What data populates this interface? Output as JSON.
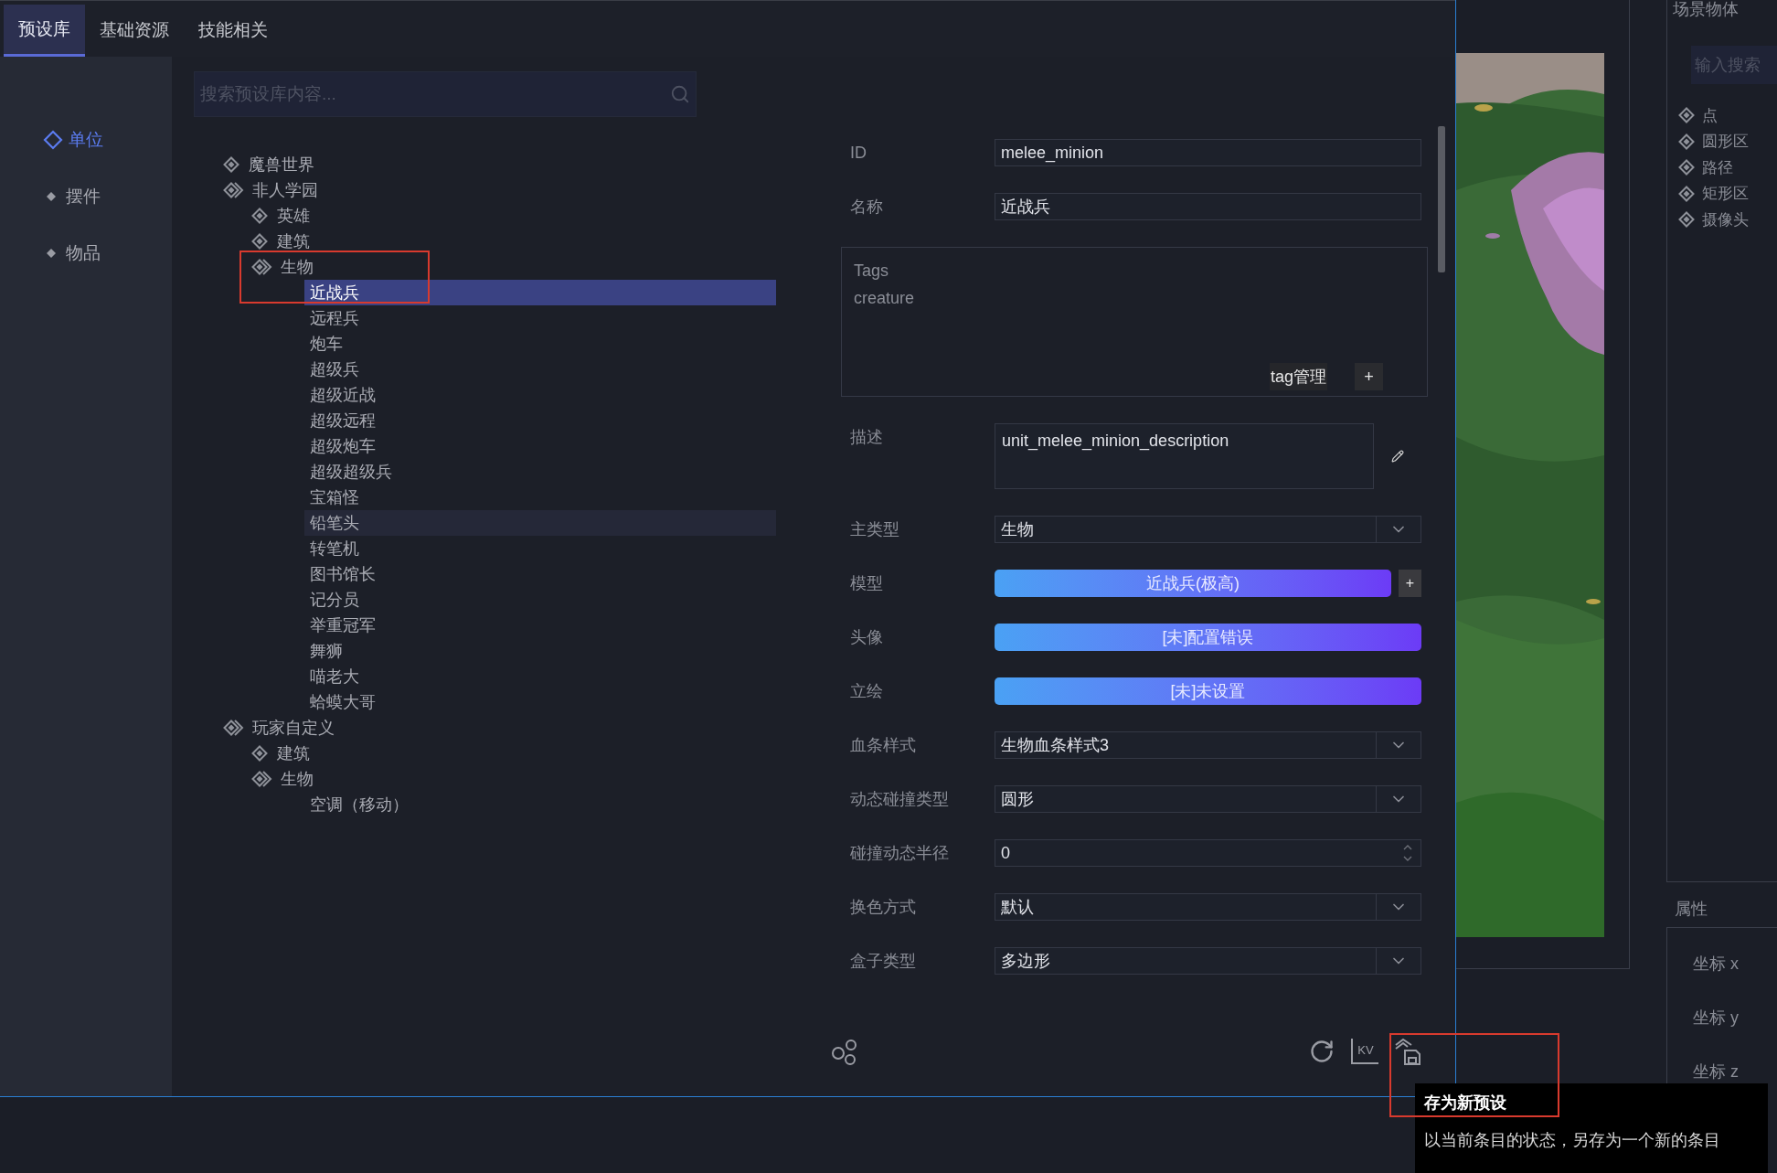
{
  "tabs": [
    {
      "label": "预设库",
      "selected": true
    },
    {
      "label": "基础资源",
      "selected": false
    },
    {
      "label": "技能相关",
      "selected": false
    }
  ],
  "sidebar": {
    "items": [
      {
        "label": "单位",
        "selected": true
      },
      {
        "label": "摆件",
        "selected": false
      },
      {
        "label": "物品",
        "selected": false
      }
    ]
  },
  "search": {
    "placeholder": "搜索预设库内容..."
  },
  "tree": [
    {
      "label": "魔兽世界",
      "expanded": false
    },
    {
      "label": "非人学园",
      "expanded": true,
      "children": [
        {
          "label": "英雄",
          "expanded": false
        },
        {
          "label": "建筑",
          "expanded": false
        },
        {
          "label": "生物",
          "expanded": true,
          "children": [
            {
              "label": "近战兵",
              "selected": true,
              "hovered": false
            },
            {
              "label": "远程兵",
              "selected": false,
              "hovered": false
            },
            {
              "label": "炮车",
              "selected": false,
              "hovered": false
            },
            {
              "label": "超级兵",
              "selected": false,
              "hovered": false
            },
            {
              "label": "超级近战",
              "selected": false,
              "hovered": false
            },
            {
              "label": "超级远程",
              "selected": false,
              "hovered": false
            },
            {
              "label": "超级炮车",
              "selected": false,
              "hovered": false
            },
            {
              "label": "超级超级兵",
              "selected": false,
              "hovered": false
            },
            {
              "label": "宝箱怪",
              "selected": false,
              "hovered": false
            },
            {
              "label": "铅笔头",
              "selected": false,
              "hovered": true
            },
            {
              "label": "转笔机",
              "selected": false,
              "hovered": false
            },
            {
              "label": "图书馆长",
              "selected": false,
              "hovered": false
            },
            {
              "label": "记分员",
              "selected": false,
              "hovered": false
            },
            {
              "label": "举重冠军",
              "selected": false,
              "hovered": false
            },
            {
              "label": "舞狮",
              "selected": false,
              "hovered": false
            },
            {
              "label": "喵老大",
              "selected": false,
              "hovered": false
            },
            {
              "label": "蛤蟆大哥",
              "selected": false,
              "hovered": false
            }
          ]
        }
      ]
    },
    {
      "label": "玩家自定义",
      "expanded": true,
      "children": [
        {
          "label": "建筑",
          "expanded": false
        },
        {
          "label": "生物",
          "expanded": true,
          "children": [
            {
              "label": "空调（移动）",
              "selected": false,
              "hovered": false
            }
          ]
        }
      ]
    }
  ],
  "form": {
    "rows": [
      {
        "kind": "text",
        "label": "ID",
        "value": "melee_minion"
      },
      {
        "kind": "text",
        "label": "名称",
        "value": "近战兵"
      },
      {
        "kind": "tags",
        "label": "Tags",
        "tags": [
          "creature"
        ],
        "manage": "tag管理",
        "add": "+"
      },
      {
        "kind": "textarea",
        "label": "描述",
        "value": "unit_melee_minion_description"
      },
      {
        "kind": "select",
        "label": "主类型",
        "value": "生物"
      },
      {
        "kind": "asset",
        "label": "模型",
        "value": "近战兵(极高)",
        "add": "+"
      },
      {
        "kind": "asset",
        "label": "头像",
        "value": "[未]配置错误"
      },
      {
        "kind": "asset",
        "label": "立绘",
        "value": "[未]未设置"
      },
      {
        "kind": "select",
        "label": "血条样式",
        "value": "生物血条样式3"
      },
      {
        "kind": "select",
        "label": "动态碰撞类型",
        "value": "圆形"
      },
      {
        "kind": "number",
        "label": "碰撞动态半径",
        "value": "0"
      },
      {
        "kind": "select",
        "label": "换色方式",
        "value": "默认"
      },
      {
        "kind": "select",
        "label": "盒子类型",
        "value": "多边形"
      }
    ]
  },
  "toolbar": {
    "kv_text": "KV"
  },
  "tooltip": {
    "title": "存为新预设",
    "text": "以当前条目的状态，另存为一个新的条目"
  },
  "scene_panel": {
    "title": "场景物体",
    "search": {
      "placeholder": "输入搜索"
    },
    "items": [
      {
        "label": "点"
      },
      {
        "label": "圆形区"
      },
      {
        "label": "路径"
      },
      {
        "label": "矩形区"
      },
      {
        "label": "摄像头"
      }
    ]
  },
  "properties": {
    "title": "属性",
    "fields": [
      {
        "label": "坐标 x"
      },
      {
        "label": "坐标 y"
      },
      {
        "label": "坐标 z"
      }
    ]
  }
}
